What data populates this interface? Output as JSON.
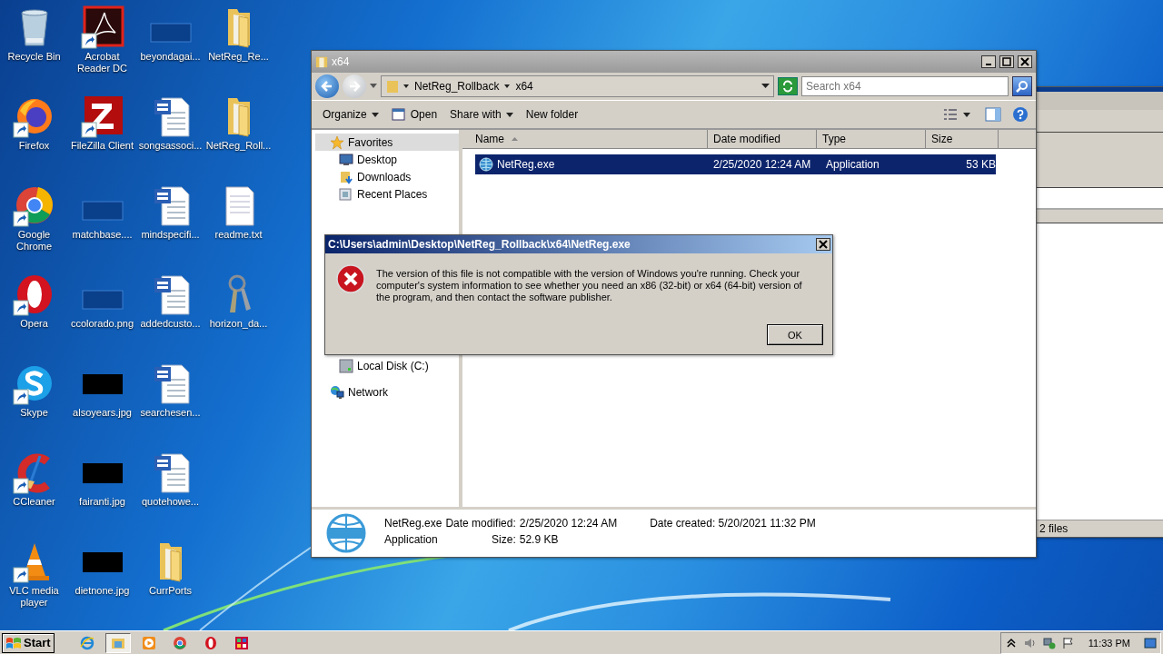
{
  "desktop": {
    "icons": [
      {
        "label": "Recycle Bin",
        "kind": "recycle",
        "shortcut": false
      },
      {
        "label": "Firefox",
        "kind": "firefox",
        "shortcut": true
      },
      {
        "label": "Google Chrome",
        "kind": "chrome",
        "shortcut": true
      },
      {
        "label": "Opera",
        "kind": "opera",
        "shortcut": true
      },
      {
        "label": "Skype",
        "kind": "skype",
        "shortcut": true
      },
      {
        "label": "CCleaner",
        "kind": "ccleaner",
        "shortcut": true
      },
      {
        "label": "VLC media player",
        "kind": "vlc",
        "shortcut": true
      },
      {
        "label": "Acrobat Reader DC",
        "kind": "acrobat",
        "shortcut": true
      },
      {
        "label": "FileZilla Client",
        "kind": "filezilla",
        "shortcut": true
      },
      {
        "label": "matchbase....",
        "kind": "image-faint",
        "shortcut": false
      },
      {
        "label": "ccolorado.png",
        "kind": "image-faint",
        "shortcut": false
      },
      {
        "label": "alsoyears.jpg",
        "kind": "image-dark",
        "shortcut": false
      },
      {
        "label": "fairanti.jpg",
        "kind": "image-dark",
        "shortcut": false
      },
      {
        "label": "dietnone.jpg",
        "kind": "image-dark",
        "shortcut": false
      },
      {
        "label": "beyondagai...",
        "kind": "image-faint",
        "shortcut": false
      },
      {
        "label": "songsassoci...",
        "kind": "word",
        "shortcut": false
      },
      {
        "label": "mindspecifi...",
        "kind": "word",
        "shortcut": false
      },
      {
        "label": "addedcusto...",
        "kind": "word",
        "shortcut": false
      },
      {
        "label": "searchesen...",
        "kind": "word",
        "shortcut": false
      },
      {
        "label": "quotehowe...",
        "kind": "word",
        "shortcut": false
      },
      {
        "label": "CurrPorts",
        "kind": "folder",
        "shortcut": false
      },
      {
        "label": "NetReg_Re...",
        "kind": "folder",
        "shortcut": false
      },
      {
        "label": "NetReg_Roll...",
        "kind": "folder",
        "shortcut": false
      },
      {
        "label": "readme.txt",
        "kind": "txt",
        "shortcut": false
      },
      {
        "label": "horizon_da...",
        "kind": "keys",
        "shortcut": false
      }
    ]
  },
  "background_window": {
    "status": "2 files"
  },
  "explorer": {
    "title": "x64",
    "breadcrumb": [
      "NetReg_Rollback",
      "x64"
    ],
    "search": {
      "placeholder": "Search x64"
    },
    "toolbar": [
      {
        "label": "Organize",
        "kind": "menu"
      },
      {
        "label": "Open",
        "kind": "open"
      },
      {
        "label": "Share with",
        "kind": "menu"
      },
      {
        "label": "New folder",
        "kind": "plain"
      }
    ],
    "nav": [
      {
        "label": "Favorites",
        "kind": "star",
        "selected": true,
        "children": [
          {
            "label": "Desktop",
            "kind": "desktop",
            "selected": false
          },
          {
            "label": "Downloads",
            "kind": "downloads",
            "selected": false
          },
          {
            "label": "Recent Places",
            "kind": "recent",
            "selected": false
          }
        ]
      },
      {
        "label": "Local Disk (C:)",
        "kind": "disk",
        "selected": false
      },
      {
        "label": "Network",
        "kind": "network",
        "selected": false
      }
    ],
    "columns": [
      {
        "label": "Name",
        "sorted": true
      },
      {
        "label": "Date modified",
        "sorted": false
      },
      {
        "label": "Type",
        "sorted": false
      },
      {
        "label": "Size",
        "sorted": false
      }
    ],
    "files": [
      {
        "name": "NetReg.exe",
        "date_modified": "2/25/2020 12:24 AM",
        "type": "Application",
        "size": "53 KB",
        "selected": true
      }
    ],
    "details": {
      "name": "NetReg.exe",
      "type": "Application",
      "fields": [
        {
          "label": "Date modified:",
          "value": "2/25/2020 12:24 AM"
        },
        {
          "label": "Size:",
          "value": "52.9 KB"
        },
        {
          "label": "Date created:",
          "value": "5/20/2021 11:32 PM"
        }
      ]
    }
  },
  "dialog": {
    "title": "C:\\Users\\admin\\Desktop\\NetReg_Rollback\\x64\\NetReg.exe",
    "message": "The version of this file is not compatible with the version of Windows you're running. Check your computer's system information to see whether you need an x86 (32-bit) or x64 (64-bit) version of the program, and then contact the software publisher.",
    "buttons": [
      "OK"
    ]
  },
  "taskbar": {
    "start": "Start",
    "apps": [
      {
        "kind": "ie",
        "active": false
      },
      {
        "kind": "explorer",
        "active": true
      },
      {
        "kind": "media",
        "active": false
      },
      {
        "kind": "chrome",
        "active": false
      },
      {
        "kind": "opera",
        "active": false
      },
      {
        "kind": "grid",
        "active": false
      }
    ],
    "clock": "11:33 PM"
  }
}
